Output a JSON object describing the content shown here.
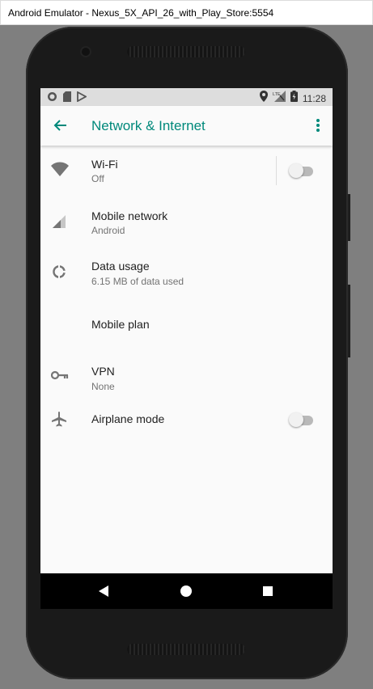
{
  "window": {
    "title": "Android Emulator - Nexus_5X_API_26_with_Play_Store:5554"
  },
  "statusbar": {
    "left_icons": [
      "record-icon",
      "sd-card-icon",
      "play-store-icon"
    ],
    "right_icons": [
      "location-icon",
      "signal-lte-icon",
      "battery-icon"
    ],
    "time": "11:28"
  },
  "appbar": {
    "title": "Network & Internet",
    "accent": "#00897b"
  },
  "items": [
    {
      "icon": "wifi-icon",
      "title": "Wi-Fi",
      "subtitle": "Off",
      "toggle": false
    },
    {
      "icon": "cell-signal-icon",
      "title": "Mobile network",
      "subtitle": "Android"
    },
    {
      "icon": "data-usage-icon",
      "title": "Data usage",
      "subtitle": "6.15 MB of data used"
    },
    {
      "title": "Mobile plan"
    },
    {
      "icon": "vpn-key-icon",
      "title": "VPN",
      "subtitle": "None"
    },
    {
      "icon": "airplane-icon",
      "title": "Airplane mode",
      "toggle": false
    }
  ],
  "navbar": {
    "buttons": [
      "nav-back-icon",
      "nav-home-icon",
      "nav-recents-icon"
    ]
  }
}
